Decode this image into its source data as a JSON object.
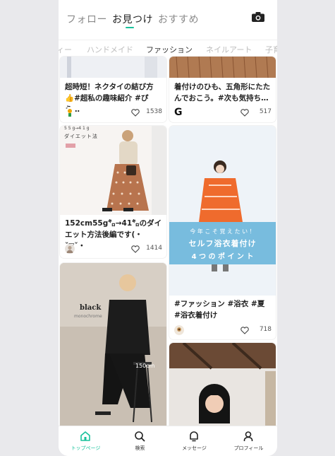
{
  "header": {
    "tabs": [
      {
        "label": "フォロー"
      },
      {
        "label": "お見つけ"
      },
      {
        "label": "おすすめ"
      }
    ]
  },
  "categories": [
    {
      "label": "ィー"
    },
    {
      "label": "ハンドメイド"
    },
    {
      "label": "ファッション"
    },
    {
      "label": "ネイルアート"
    },
    {
      "label": "子育"
    }
  ],
  "cards": {
    "c1": {
      "title": "超時短！ネクタイの結び方👍#超私の趣味紹介 #ぴえ…",
      "likes": "1538"
    },
    "c2": {
      "title": "着付けのひも、五角形にたたんでおこう。#次も気持ち…",
      "likes": "517",
      "author_letter": "G"
    },
    "c3": {
      "title": "152cm55g㌔→41㌔のダイエット方法後編です(・ˇ▽ˇ・",
      "likes": "1414",
      "overlay_top": "ダイエット法",
      "overlay_small": "5 5 g→4 1 g"
    },
    "c4": {
      "title": "#ファッション #浴衣 #夏 #浴衣着付け",
      "likes": "718",
      "overlay_line1": "今 年 こ そ 覚 え た い ！",
      "overlay_line2": "セルフ浴衣着付け",
      "overlay_line3": "4 つ の ポ イ ン ト"
    },
    "c5": {
      "overlay_title": "black",
      "overlay_sub": "monochrome",
      "overlay_height": "150cm"
    }
  },
  "bottom_nav": [
    {
      "label": "トップページ",
      "icon": "home-icon"
    },
    {
      "label": "検索",
      "icon": "search-icon"
    },
    {
      "label": "メッセージ",
      "icon": "bell-icon"
    },
    {
      "label": "プロフィール",
      "icon": "profile-icon"
    }
  ],
  "colors": {
    "accent": "#19c29b"
  }
}
